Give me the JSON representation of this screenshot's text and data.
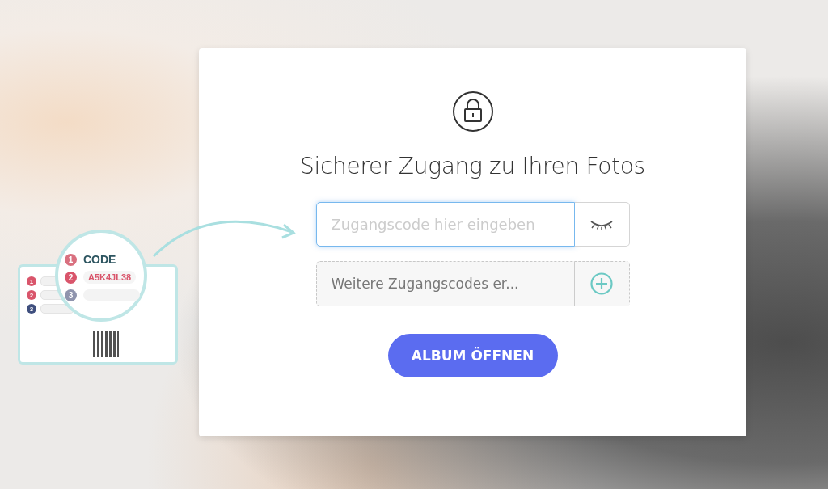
{
  "illustration": {
    "heading": "CODE",
    "code": "A5K4JL38",
    "coupon_steps": [
      "1",
      "2",
      "3"
    ],
    "lens_steps": [
      "1",
      "2",
      "3"
    ]
  },
  "dialog": {
    "title": "Sicherer Zugang zu Ihren Fotos",
    "code_field": {
      "placeholder": "Zugangscode hier eingeben"
    },
    "add_code": {
      "label": "Weitere Zugangscodes er..."
    },
    "submit": {
      "label": "ALBUM ÖFFNEN"
    }
  }
}
